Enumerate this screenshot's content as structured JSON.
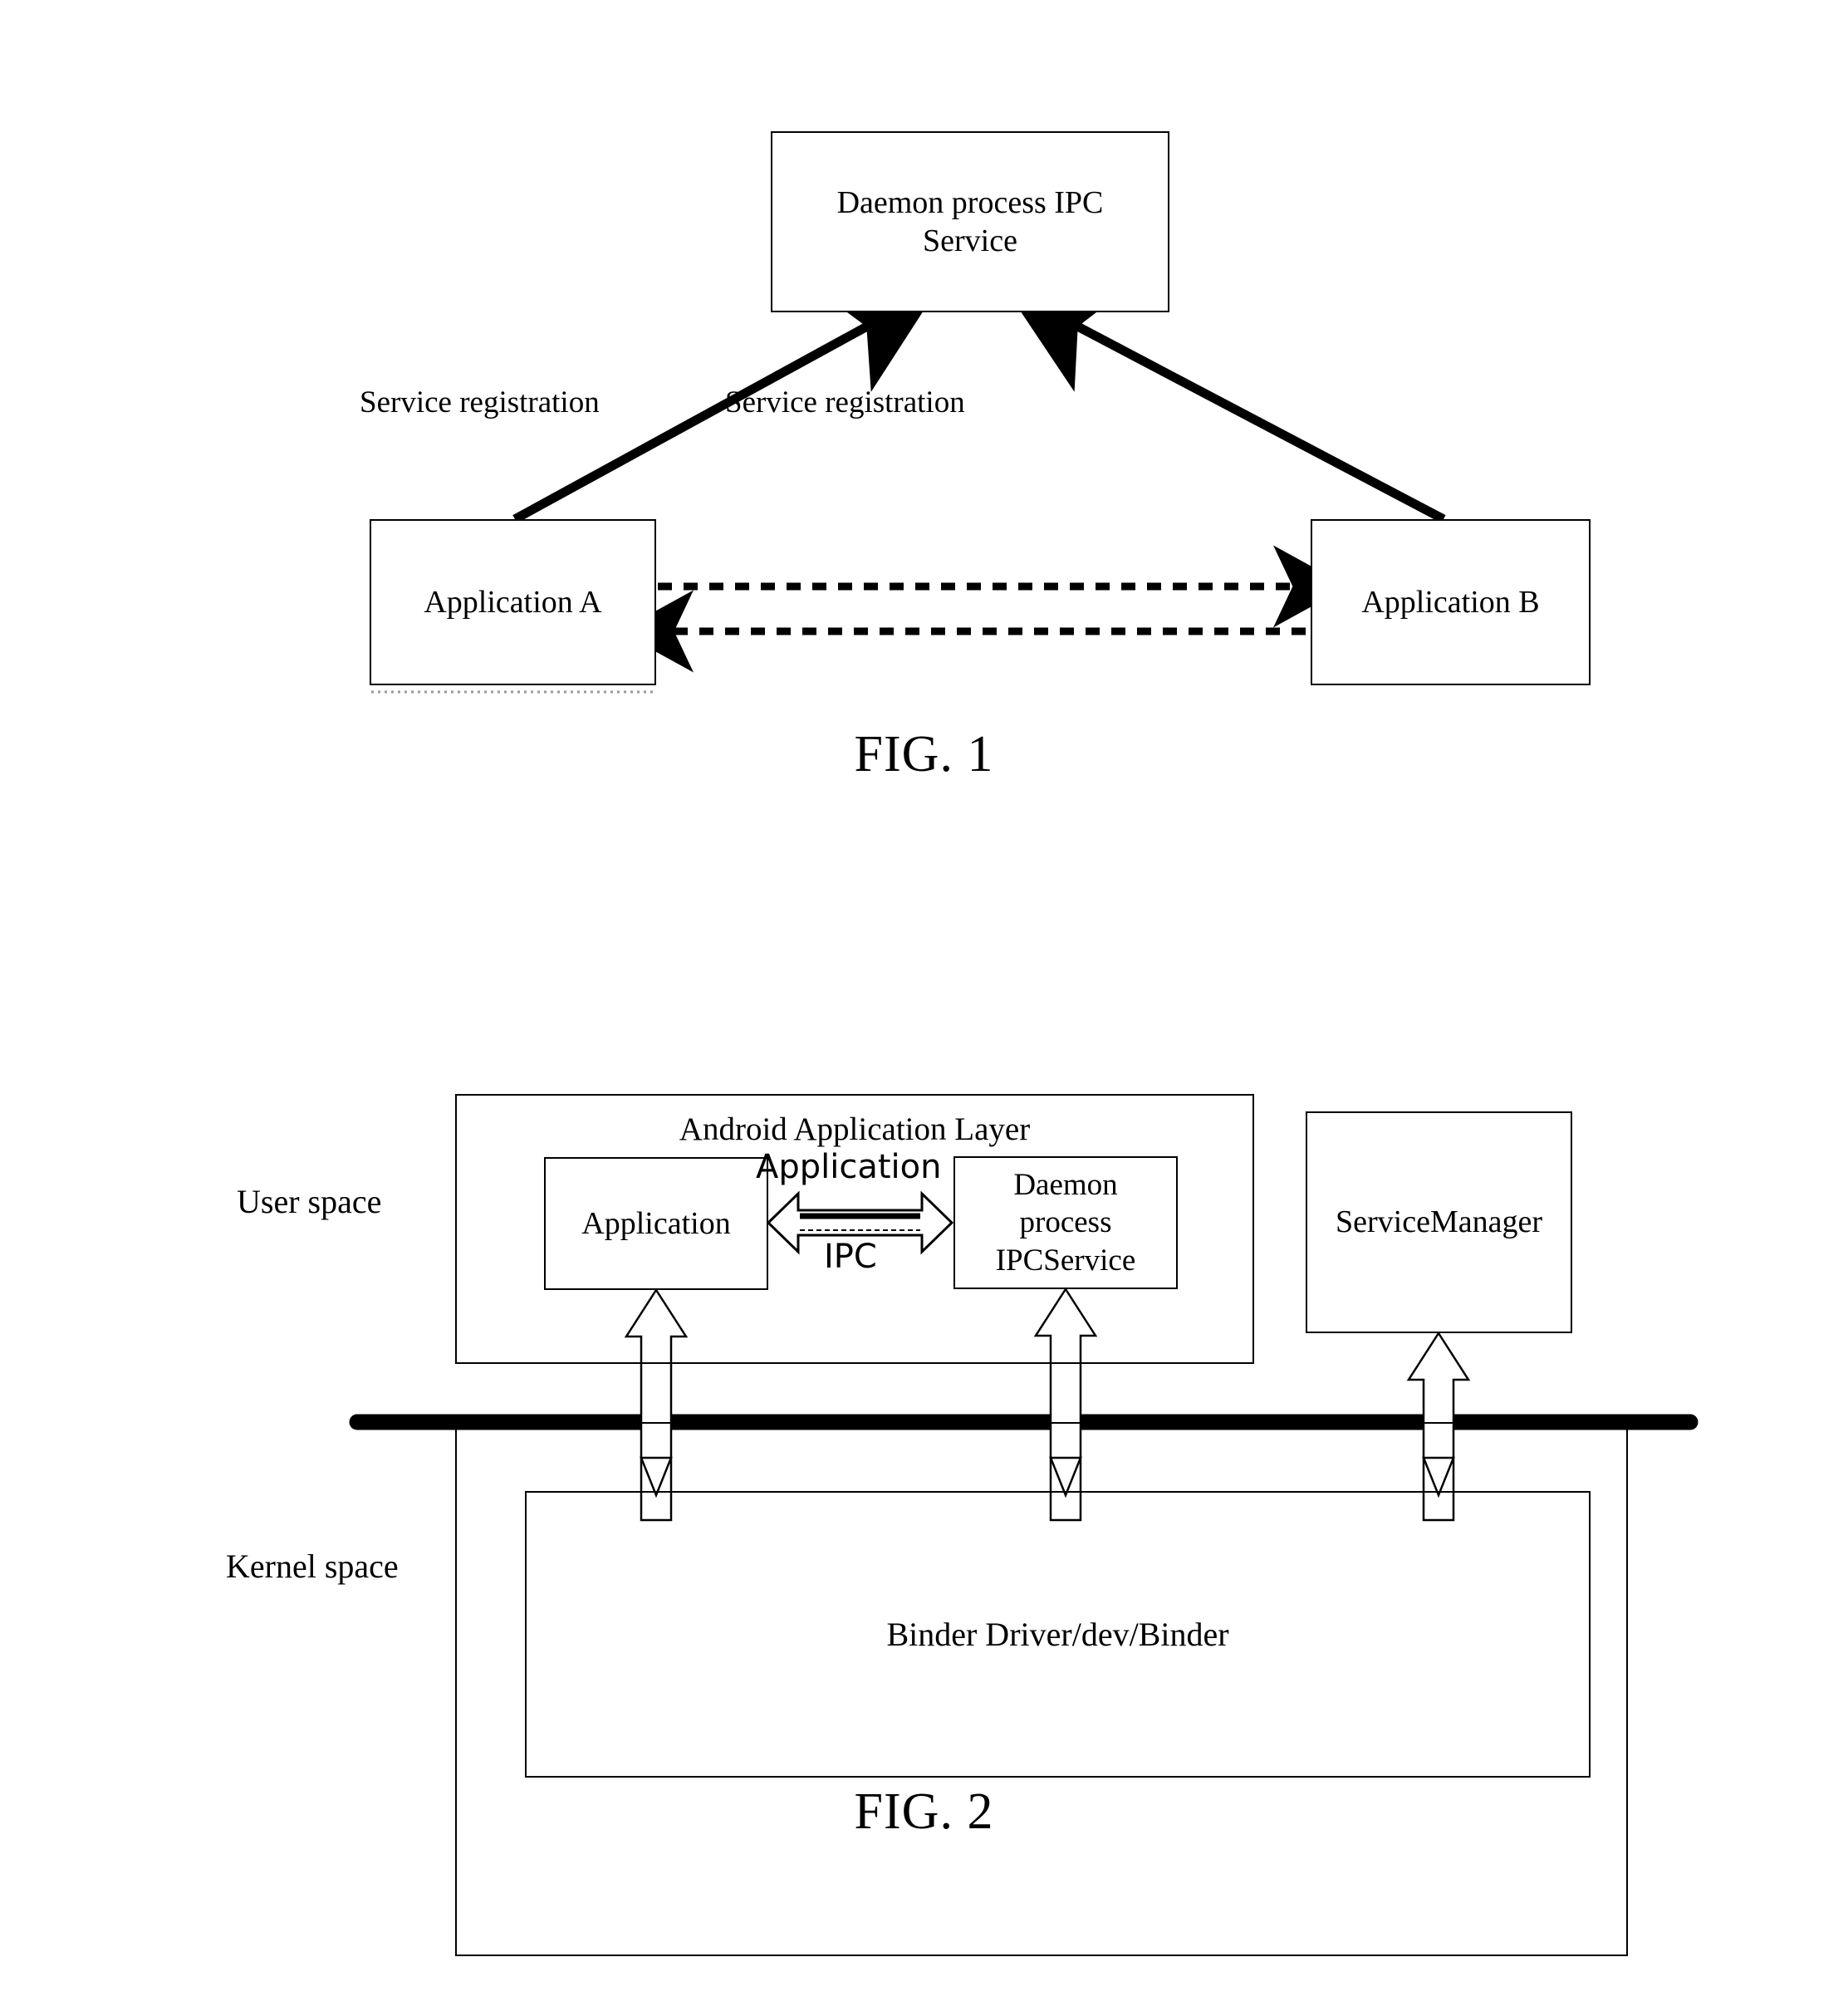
{
  "figures": [
    {
      "id": "fig1",
      "caption": "FIG. 1",
      "nodes": {
        "daemon": "Daemon process IPC\nService",
        "app_a": "Application A",
        "app_b": "Application B"
      },
      "edge_labels": {
        "registration_left": "Service registration",
        "registration_right": "Service registration"
      }
    },
    {
      "id": "fig2",
      "caption": "FIG. 2",
      "regions": {
        "user_space": "User space",
        "kernel_space": "Kernel space"
      },
      "nodes": {
        "android_layer": "Android Application Layer",
        "application": "Application",
        "daemon_ipcservice": "Daemon\nprocess\nIPCService",
        "service_manager": "ServiceManager",
        "binder_driver": "Binder Driver/dev/Binder"
      },
      "edge_labels": {
        "application": "Application",
        "ipc": "IPC"
      }
    }
  ],
  "colors": {
    "stroke": "#000000",
    "background": "#ffffff"
  }
}
